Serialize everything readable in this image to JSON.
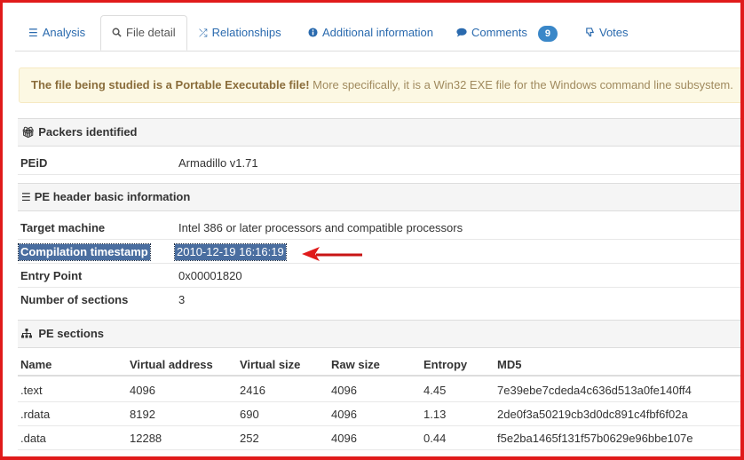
{
  "tabs": [
    {
      "label": "Analysis",
      "icon": "list-icon",
      "active": false
    },
    {
      "label": "File detail",
      "icon": "search-icon",
      "active": true
    },
    {
      "label": "Relationships",
      "icon": "shuffle-icon",
      "active": false
    },
    {
      "label": "Additional information",
      "icon": "info-icon",
      "active": false
    },
    {
      "label": "Comments",
      "icon": "comment-icon",
      "active": false,
      "badge": "9"
    },
    {
      "label": "Votes",
      "icon": "thumbs-down-icon",
      "active": false
    }
  ],
  "alert": {
    "bold": "The file being studied is a Portable Executable file!",
    "rest": "More specifically, it is a Win32 EXE file for the Windows command line subsystem."
  },
  "packers": {
    "title": "Packers identified",
    "rows": [
      {
        "key": "PEiD",
        "value": "Armadillo v1.71"
      }
    ]
  },
  "pe_header": {
    "title": "PE header basic information",
    "rows": [
      {
        "key": "Target machine",
        "value": "Intel 386 or later processors and compatible processors"
      },
      {
        "key": "Compilation timestamp",
        "value": "2010-12-19 16:16:19"
      },
      {
        "key": "Entry Point",
        "value": "0x00001820"
      },
      {
        "key": "Number of sections",
        "value": "3"
      }
    ]
  },
  "pe_sections": {
    "title": "PE sections",
    "columns": [
      "Name",
      "Virtual address",
      "Virtual size",
      "Raw size",
      "Entropy",
      "MD5"
    ],
    "rows": [
      [
        ".text",
        "4096",
        "2416",
        "4096",
        "4.45",
        "7e39ebe7cdeda4c636d513a0fe140ff4"
      ],
      [
        ".rdata",
        "8192",
        "690",
        "4096",
        "1.13",
        "2de0f3a50219cb3d0dc891c4fbf6f02a"
      ],
      [
        ".data",
        "12288",
        "252",
        "4096",
        "0.44",
        "f5e2ba1465f131f57b0629e96bbe107e"
      ]
    ]
  },
  "colors": {
    "frame": "#e01b1b",
    "link": "#2a6aae",
    "badge": "#3a87c8",
    "alert_bg": "#fcf8e3",
    "alert_text": "#8a6d3b",
    "highlight": "#4a6ea0",
    "arrow": "#e01b1b"
  }
}
